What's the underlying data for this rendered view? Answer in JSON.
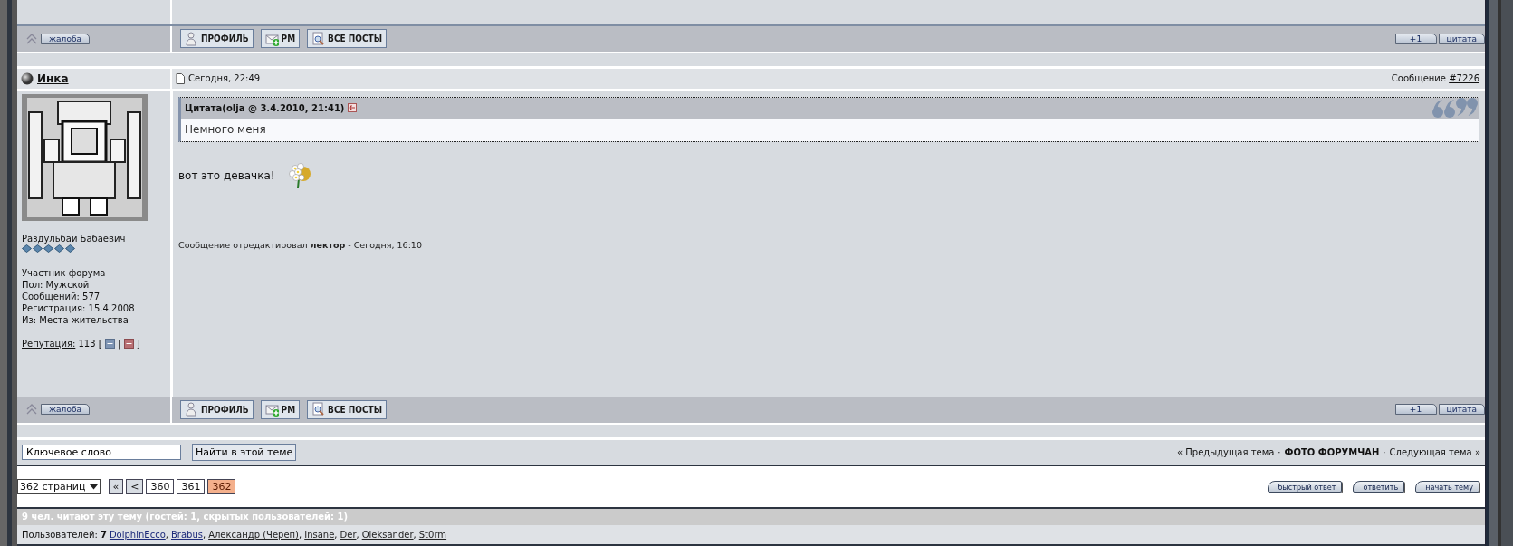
{
  "post_bars": [
    {
      "report": "жалоба",
      "buttons": [
        {
          "kind": "profile",
          "label": "ПРОФИЛЬ"
        },
        {
          "kind": "pm",
          "label": "РМ"
        },
        {
          "kind": "posts",
          "label": "ВСЕ ПОСТЫ"
        }
      ],
      "plus_one": "+1",
      "quote": "цитата"
    }
  ],
  "post": {
    "author": "Инка",
    "date": "Сегодня, 22:49",
    "number_label": "Сообщение",
    "number": "#7226",
    "user": {
      "title": "Раздульбай Бабаевич",
      "stars": 5,
      "details": [
        "Участник форума",
        "Пол: Мужской",
        "Сообщений: 577",
        "Регистрация: 15.4.2008",
        "Из: Места жительства"
      ],
      "reputation_label": "Репутация:",
      "reputation": "113 [",
      "rep_separator": "|",
      "rep_close": "]"
    },
    "quote": {
      "header": "Цитата(olja @ 3.4.2010, 21:41)",
      "body": "Немного меня"
    },
    "message": "вот это девачка!",
    "edit_note": "Сообщение отредактировал **лектор** - Сегодня, 16:10",
    "bar": {
      "report": "жалоба",
      "buttons": [
        {
          "kind": "profile",
          "label": "ПРОФИЛЬ"
        },
        {
          "kind": "pm",
          "label": "РМ"
        },
        {
          "kind": "posts",
          "label": "ВСЕ ПОСТЫ"
        }
      ],
      "plus_one": "+1",
      "quote": "цитата"
    }
  },
  "search": {
    "value": "Ключевое слово",
    "button": "Найти в этой теме"
  },
  "topic_nav": {
    "previous": "« Предыдущая тема",
    "separator_1": "·",
    "title": "ФОТО ФОРУМЧАН",
    "separator_2": "·",
    "next": "Следующая тема »"
  },
  "pagination": {
    "select": "362 страниц",
    "pages": [
      {
        "label": "«",
        "selected": false
      },
      {
        "label": "<",
        "selected": false
      },
      {
        "label": "360",
        "selected": false
      },
      {
        "label": "361",
        "selected": false
      },
      {
        "label": "362",
        "selected": true
      }
    ]
  },
  "actions": [
    "быстрый ответ",
    "ответить",
    "начать тему"
  ],
  "online": {
    "header": "9 чел. читают эту тему (гостей: 1, скрытых пользователей: 1)",
    "users_label": "Пользователей:",
    "count": "7",
    "users": [
      "DolphinEcco",
      "Brabus",
      "Александр (Череп)",
      "Insane",
      "Der",
      "Oleksander",
      "St0rm"
    ],
    "separator": ","
  }
}
